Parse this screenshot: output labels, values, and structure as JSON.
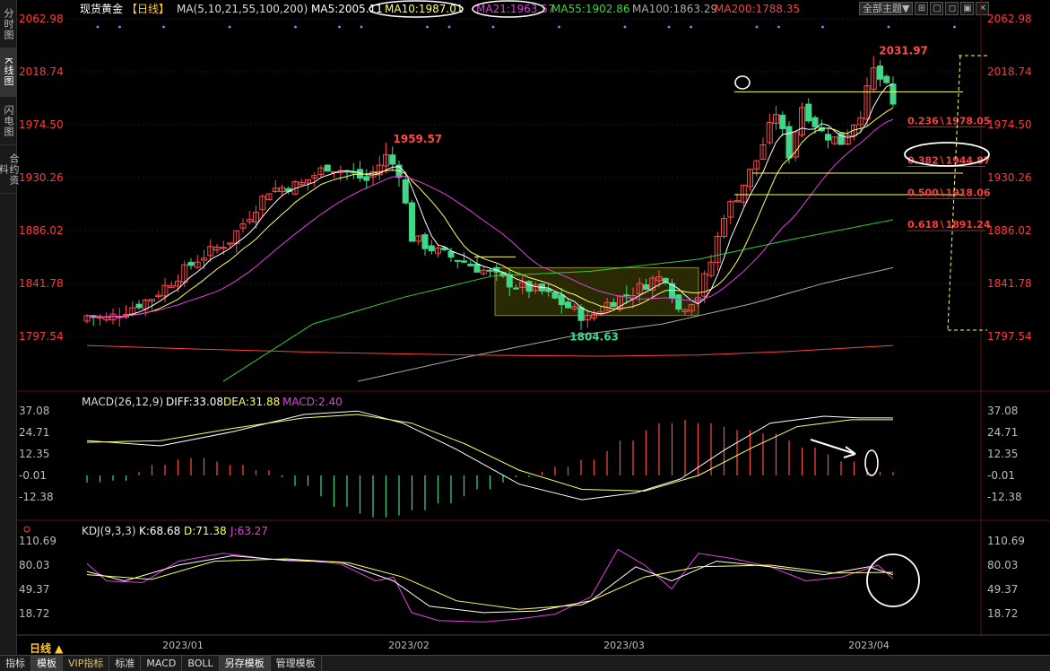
{
  "side_tabs": [
    {
      "label": "分时图",
      "active": false
    },
    {
      "label": "K线图",
      "active": true
    },
    {
      "label": "闪电图",
      "active": false
    },
    {
      "label": "合约资料",
      "active": false
    }
  ],
  "header": {
    "instrument": "现货黄金",
    "period": "【日线】",
    "ma_title": "MA(5,10,21,55,100,200)",
    "ma5": "MA5:2005.11",
    "ma10": "MA10:1987.01",
    "ma21": "MA21:1963.57",
    "ma55": "MA55:1902.86",
    "ma100": "MA100:1863.29",
    "ma200": "MA200:1788.35",
    "theme_button": "全部主题▼",
    "icon_buttons": [
      "⊞",
      "□",
      "◻",
      "▣",
      "✕"
    ]
  },
  "colors": {
    "up": "#ff4a4a",
    "down": "#3fd88a",
    "ma5": "#ffffff",
    "ma10": "#ffff66",
    "ma21": "#e040e0",
    "ma55": "#33cc33",
    "ma100": "#aaaaaa",
    "ma200": "#ff4040",
    "axis": "#ff3b3b",
    "fib": "#ffff66"
  },
  "main_axis": {
    "ticks": [
      "2062.98",
      "2018.74",
      "1974.50",
      "1930.26",
      "1886.02",
      "1841.78",
      "1797.54"
    ]
  },
  "annotations": {
    "high": "2031.97",
    "peak": "1959.57",
    "low": "1804.63",
    "fib": [
      {
        "label": "0.236∖1978.05",
        "value": 1978.05
      },
      {
        "label": "0.382∖1944.87",
        "value": 1944.87
      },
      {
        "label": "0.500∖1918.06",
        "value": 1918.06
      },
      {
        "label": "0.618∖1891.24",
        "value": 1891.24
      }
    ]
  },
  "macd": {
    "title": "MACD(26,12,9)",
    "diff": "DIFF:33.08",
    "dea": "DEA:31.88",
    "macd": "MACD:2.40",
    "ticks": [
      "37.08",
      "24.71",
      "12.35",
      "-0.01",
      "-12.38"
    ]
  },
  "kdj": {
    "title": "KDJ(9,3,3)",
    "k": "K:68.68",
    "d": "D:71.38",
    "j": "J:63.27",
    "ticks": [
      "110.69",
      "80.03",
      "49.37",
      "18.72"
    ]
  },
  "x_axis": {
    "period_label": "日线 ▲",
    "dates": [
      "2023/01",
      "2023/02",
      "2023/03",
      "2023/04"
    ]
  },
  "toolbar": [
    {
      "label": "指标",
      "active": false,
      "vip": false
    },
    {
      "label": "模板",
      "active": true,
      "vip": false
    },
    {
      "label": "VIP指标",
      "active": false,
      "vip": true
    },
    {
      "label": "标准",
      "active": false,
      "vip": false
    },
    {
      "label": "MACD",
      "active": false,
      "vip": false
    },
    {
      "label": "BOLL",
      "active": false,
      "vip": false
    },
    {
      "label": "另存模板",
      "active": true,
      "vip": false
    },
    {
      "label": "管理模板",
      "active": false,
      "vip": false
    }
  ]
}
